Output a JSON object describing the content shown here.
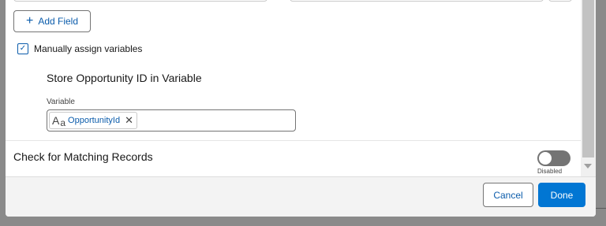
{
  "form": {
    "add_field_label": "Add Field",
    "manual_assign_label": "Manually assign variables",
    "manual_assign_checked": true,
    "section_title": "Store Opportunity ID in Variable",
    "variable_label": "Variable",
    "variable_value": "OpportunityId",
    "variable_type_icon": "text-type-icon"
  },
  "matching": {
    "title": "Check for Matching Records",
    "toggle_state_label": "Disabled",
    "toggle_on": false
  },
  "footer": {
    "cancel_label": "Cancel",
    "done_label": "Done"
  },
  "colors": {
    "accent": "#0176d3",
    "link": "#0b5cab",
    "toggle_off": "#747474"
  }
}
